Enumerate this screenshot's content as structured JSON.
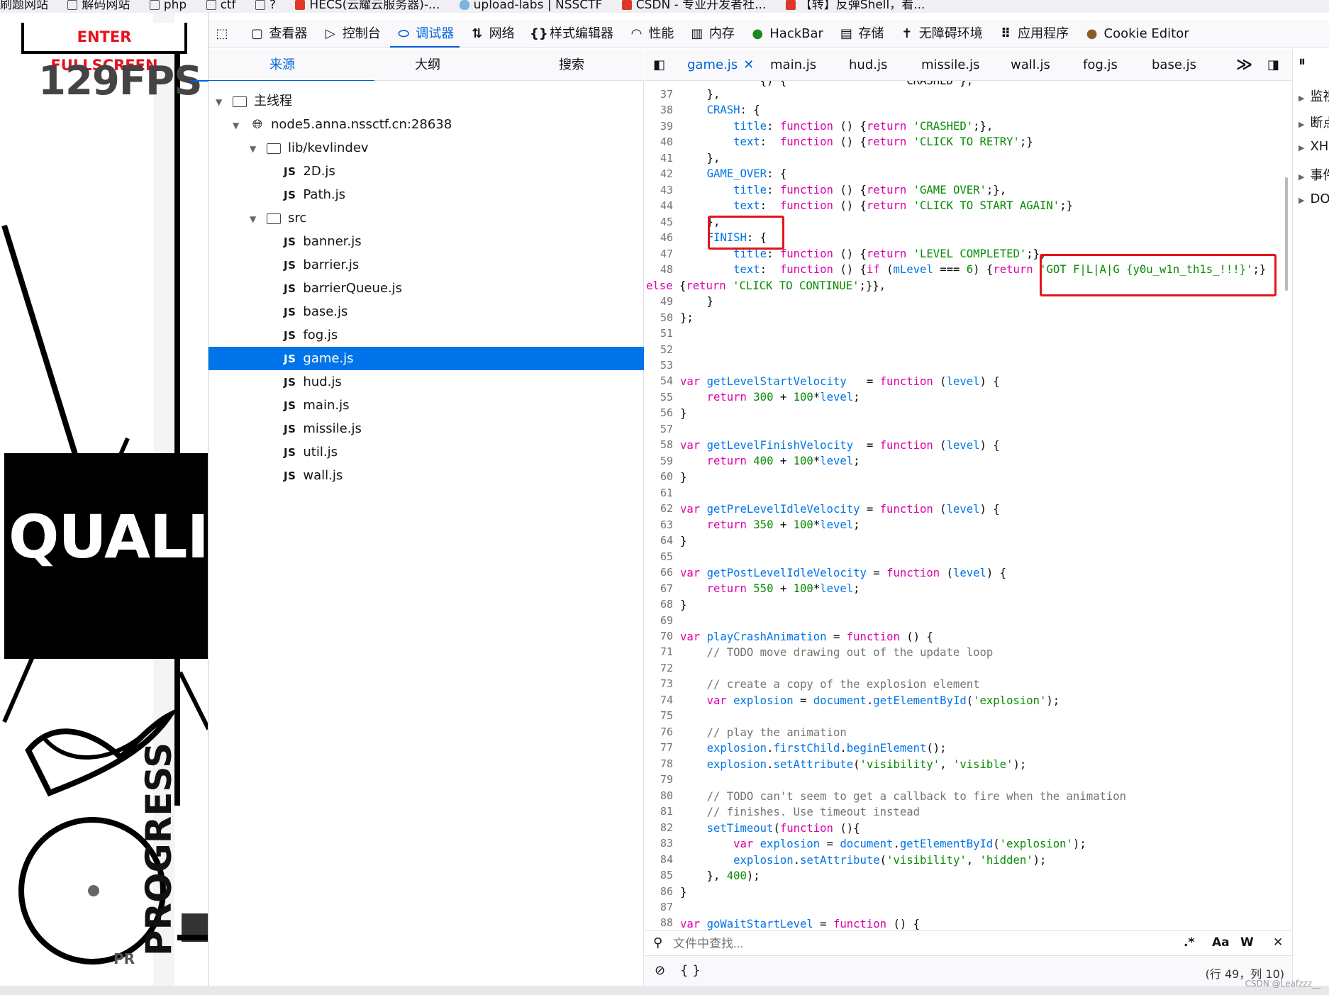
{
  "bookmarks": [
    {
      "label": "刷题网站",
      "icon": "folder-icon"
    },
    {
      "label": "解码网站",
      "icon": "folder-icon"
    },
    {
      "label": "php",
      "icon": "folder-icon"
    },
    {
      "label": "ctf",
      "icon": "folder-icon"
    },
    {
      "label": "?",
      "icon": "folder-icon"
    },
    {
      "label": "HECS(云耀云服务器)-...",
      "icon": "huawei-icon"
    },
    {
      "label": "upload-labs | NSSCTF",
      "icon": "cloud-icon"
    },
    {
      "label": "CSDN - 专业开发者社...",
      "icon": "csdn-icon"
    },
    {
      "label": "【转】反弹Shell，看...",
      "icon": "csdn-icon"
    }
  ],
  "game": {
    "fullscreen_button": "ENTER FULLSCREEN",
    "fps": "129FPS",
    "quality": "QUALI",
    "progress": "PROGRESS",
    "pr": "PR"
  },
  "toolbar": {
    "tools": [
      {
        "label": "",
        "icon": "pick-element-icon"
      },
      {
        "label": "查看器",
        "icon": "inspector-icon"
      },
      {
        "label": "控制台",
        "icon": "console-icon"
      },
      {
        "label": "调试器",
        "icon": "debugger-icon",
        "active": true
      },
      {
        "label": "网络",
        "icon": "network-icon"
      },
      {
        "label": "样式编辑器",
        "icon": "style-editor-icon"
      },
      {
        "label": "性能",
        "icon": "performance-icon"
      },
      {
        "label": "内存",
        "icon": "memory-icon"
      },
      {
        "label": "HackBar",
        "icon": "hackbar-icon"
      },
      {
        "label": "存储",
        "icon": "storage-icon"
      },
      {
        "label": "无障碍环境",
        "icon": "accessibility-icon"
      },
      {
        "label": "应用程序",
        "icon": "application-icon"
      },
      {
        "label": "Cookie Editor",
        "icon": "cookie-icon"
      }
    ]
  },
  "source_tabs": {
    "sources": "来源",
    "outline": "大纲",
    "search": "搜索"
  },
  "tree": {
    "main_thread": "主线程",
    "host": "node5.anna.nssctf.cn:28638",
    "lib_folder": "lib/kevlindev",
    "lib_files": [
      "2D.js",
      "Path.js"
    ],
    "src_folder": "src",
    "src_files": [
      "banner.js",
      "barrier.js",
      "barrierQueue.js",
      "base.js",
      "fog.js",
      "game.js",
      "hud.js",
      "main.js",
      "missile.js",
      "util.js",
      "wall.js"
    ],
    "selected": "game.js",
    "js_label": "JS"
  },
  "editor_tabs": [
    "game.js",
    "main.js",
    "hud.js",
    "missile.js",
    "wall.js",
    "fog.js",
    "base.js"
  ],
  "editor": {
    "active_tab": "game.js",
    "line_numbers": [
      "37",
      "38",
      "39",
      "40",
      "41",
      "42",
      "43",
      "44",
      "45",
      "46",
      "47",
      "48",
      "",
      "49",
      "50",
      "51",
      "52",
      "53",
      "54",
      "55",
      "56",
      "57",
      "58",
      "59",
      "60",
      "61",
      "62",
      "63",
      "64",
      "65",
      "66",
      "67",
      "68",
      "69",
      "70",
      "71",
      "72",
      "73",
      "74",
      "75",
      "76",
      "77",
      "78",
      "79",
      "80",
      "81",
      "82",
      "83",
      "84",
      "85",
      "86",
      "87",
      "88"
    ]
  },
  "side_panel": [
    "监视",
    "断点",
    "XHR",
    "事件",
    "DOM"
  ],
  "search": {
    "placeholder": "文件中查找...",
    "regex": ".*",
    "case": "Aa",
    "whole": "W"
  },
  "status": {
    "left": "{ }",
    "position": "(行 49，列 10)"
  },
  "watermark": "CSDN @Leafzzz__"
}
